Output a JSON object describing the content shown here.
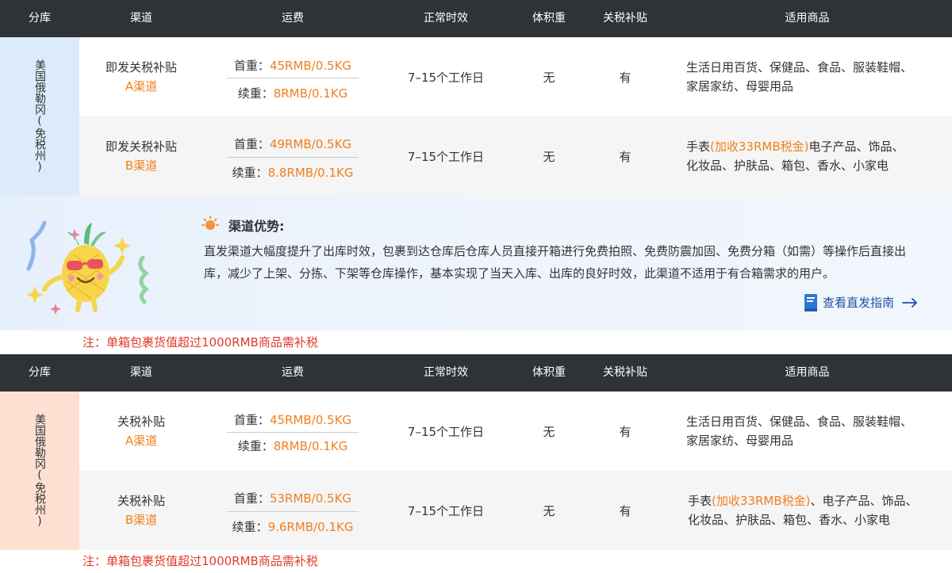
{
  "columns": [
    "分库",
    "渠道",
    "运费",
    "正常时效",
    "体积重",
    "关税补贴",
    "适用商品"
  ],
  "section1": {
    "warehouse": "美国俄勒冈(免税州)",
    "rows": [
      {
        "channel_name": "即发关税补贴",
        "channel_sub": "A渠道",
        "first_label": "首重：",
        "first_value": "45RMB/0.5KG",
        "cont_label": "续重：",
        "cont_value": "8RMB/0.1KG",
        "time": "7–15个工作日",
        "volume": "无",
        "tariff": "有",
        "goods_hl": "",
        "goods_line1": "生活日用百货、保健品、食品、服装鞋帽、",
        "goods_line2": "家居家纺、母婴用品"
      },
      {
        "channel_name": "即发关税补贴",
        "channel_sub": "B渠道",
        "first_label": "首重：",
        "first_value": "49RMB/0.5KG",
        "cont_label": "续重：",
        "cont_value": "8.8RMB/0.1KG",
        "time": "7–15个工作日",
        "volume": "无",
        "tariff": "有",
        "goods_pre": "手表",
        "goods_hl": "(加收33RMB税金)",
        "goods_line1": "电子产品、饰品、",
        "goods_line2": "化妆品、护肤品、箱包、香水、小家电"
      }
    ]
  },
  "advantage": {
    "title": "渠道优势:",
    "body": "直发渠道大幅度提升了出库时效，包裹到达仓库后仓库人员直接开箱进行免费拍照、免费防震加固、免费分箱（如需）等操作后直接出库，减少了上架、分拣、下架等仓库操作，基本实现了当天入库、出库的良好时效，此渠道不适用于有合箱需求的用户。",
    "link": "查看直发指南",
    "icons": {
      "sun": "sun-icon",
      "book": "book-icon",
      "arrow": "arrow-right-icon",
      "mascot": "pineapple-mascot"
    }
  },
  "note": "注：单箱包裹货值超过1000RMB商品需补税",
  "section2": {
    "warehouse": "美国俄勒冈(免税州)",
    "rows": [
      {
        "channel_name": "关税补贴",
        "channel_sub": "A渠道",
        "first_label": "首重：",
        "first_value": "45RMB/0.5KG",
        "cont_label": "续重：",
        "cont_value": "8RMB/0.1KG",
        "time": "7–15个工作日",
        "volume": "无",
        "tariff": "有",
        "goods_hl": "",
        "goods_line1": "生活日用百货、保健品、食品、服装鞋帽、",
        "goods_line2": "家居家纺、母婴用品"
      },
      {
        "channel_name": "关税补贴",
        "channel_sub": "B渠道",
        "first_label": "首重：",
        "first_value": "53RMB/0.5KG",
        "cont_label": "续重：",
        "cont_value": "9.6RMB/0.1KG",
        "time": "7–15个工作日",
        "volume": "无",
        "tariff": "有",
        "goods_pre": "手表",
        "goods_hl": "(加收33RMB税金)",
        "goods_line1": "、电子产品、饰品、",
        "goods_line2": "化妆品、护肤品、箱包、香水、小家电"
      }
    ]
  },
  "colors": {
    "header_bg": "#2f3338",
    "accent_orange": "#f27f1e",
    "note_red": "#e03a2b",
    "warehouse1_bg": "#dcebfc",
    "warehouse2_bg": "#fde0d2",
    "link_blue": "#1e4fa3"
  }
}
